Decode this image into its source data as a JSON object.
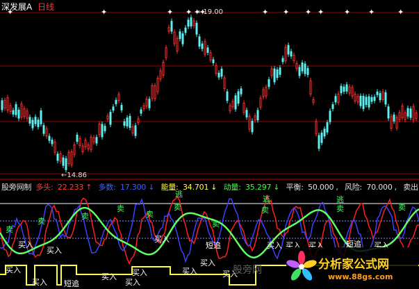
{
  "header": {
    "symbol": "深发展A",
    "period": "日线"
  },
  "main_chart": {
    "high_label": "19.00",
    "low_label": "14.86"
  },
  "indicator": {
    "name": "股旁网制",
    "items": [
      {
        "label": "多头:",
        "value": "22.233",
        "arrow": "↑",
        "color": "#ff4040"
      },
      {
        "label": "多数:",
        "value": "17.300",
        "arrow": "↓",
        "color": "#4060ff"
      },
      {
        "label": "能量:",
        "value": "34.701",
        "arrow": "↓",
        "color": "#ffff40"
      },
      {
        "label": "动量:",
        "value": "35.297",
        "arrow": "↓",
        "color": "#40ff40"
      },
      {
        "label": "平衡:",
        "value": "50.000",
        "arrow": ",",
        "color": "#e0e0e0"
      },
      {
        "label": "风险:",
        "value": "70.000",
        "arrow": ",",
        "color": "#e0e0e0"
      },
      {
        "label": "卖出:",
        "value": "",
        "arrow": "",
        "color": "#e0e0e0"
      }
    ]
  },
  "signals": {
    "buy": "买入",
    "sell": "卖",
    "escape": "逃",
    "short_chase": "短追"
  },
  "watermark": {
    "cn": "分析家公式网",
    "url": "www.88gs.com",
    "faint": "股旁网"
  },
  "colors": {
    "bg": "#000000",
    "up_candle": "#ff3030",
    "down_candle": "#60f0f0",
    "grid": "#a00000"
  }
}
